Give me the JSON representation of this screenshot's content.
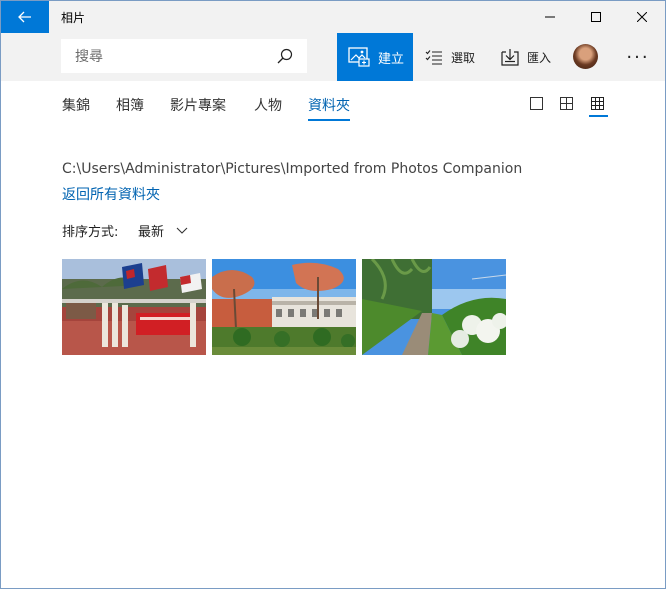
{
  "titlebar": {
    "app_title": "相片"
  },
  "cmdbar": {
    "search_placeholder": "搜尋",
    "create_label": "建立",
    "select_label": "選取",
    "import_label": "匯入",
    "more_label": "···"
  },
  "tabs": [
    {
      "label": "集錦"
    },
    {
      "label": "相簿"
    },
    {
      "label": "影片專案"
    },
    {
      "label": "人物"
    },
    {
      "label": "資料夾"
    }
  ],
  "active_tab": "資料夾",
  "view_modes": [
    "single",
    "medium-grid",
    "small-grid"
  ],
  "selected_view": "small-grid",
  "folder": {
    "path": "C:\\Users\\Administrator\\Pictures\\Imported from Photos Companion",
    "back_link": "返回所有資料夾"
  },
  "sort": {
    "label": "排序方式:",
    "value": "最新"
  },
  "photos": [
    {
      "subject": "school-parade-with-flags"
    },
    {
      "subject": "flowering-trees-and-building"
    },
    {
      "subject": "garden-path-with-palms"
    }
  ],
  "colors": {
    "accent": "#0078d7",
    "link": "#0063b1",
    "bar": "#f2f2f2"
  }
}
